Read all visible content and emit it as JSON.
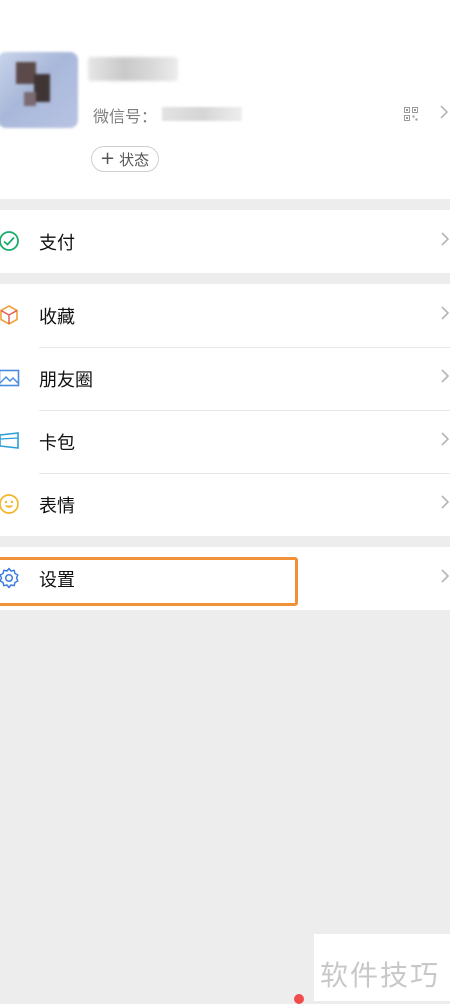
{
  "profile": {
    "wechat_id_label": "微信号：",
    "status_button": "状态",
    "status_plus": "+"
  },
  "menu": {
    "pay": {
      "label": "支付",
      "icon": "wallet-check-icon"
    },
    "favorites": {
      "label": "收藏",
      "icon": "cube-icon"
    },
    "moments": {
      "label": "朋友圈",
      "icon": "image-icon"
    },
    "cards": {
      "label": "卡包",
      "icon": "card-icon"
    },
    "stickers": {
      "label": "表情",
      "icon": "smiley-icon"
    },
    "settings": {
      "label": "设置",
      "icon": "gear-icon"
    }
  },
  "watermark": {
    "text": "软件技巧"
  },
  "colors": {
    "background": "#ededed",
    "highlight": "#f0913a",
    "pay_green": "#1aad6b",
    "favorites_orange": "#f2a23a",
    "moments_blue": "#4a8de0",
    "cards_teal": "#2c9fd6",
    "stickers_yellow": "#f2b62b",
    "settings_blue": "#3b7de0"
  }
}
